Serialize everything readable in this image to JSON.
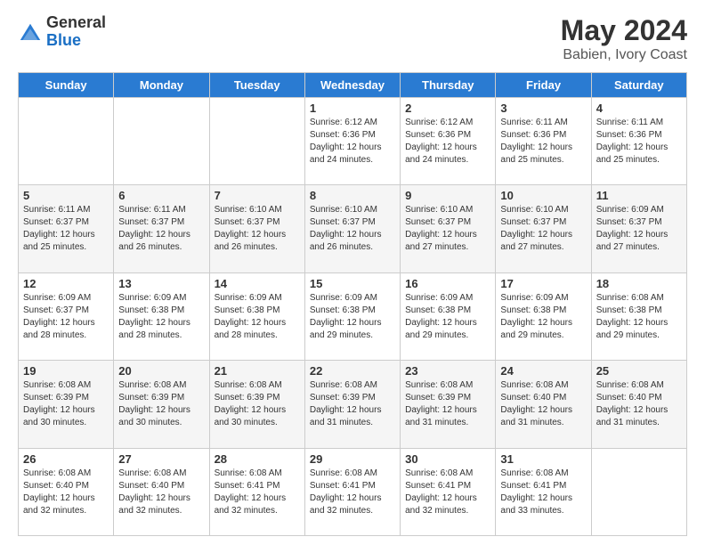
{
  "logo": {
    "general": "General",
    "blue": "Blue"
  },
  "header": {
    "month": "May 2024",
    "location": "Babien, Ivory Coast"
  },
  "days_of_week": [
    "Sunday",
    "Monday",
    "Tuesday",
    "Wednesday",
    "Thursday",
    "Friday",
    "Saturday"
  ],
  "weeks": [
    [
      {
        "day": null,
        "info": null
      },
      {
        "day": null,
        "info": null
      },
      {
        "day": null,
        "info": null
      },
      {
        "day": "1",
        "info": "Sunrise: 6:12 AM\nSunset: 6:36 PM\nDaylight: 12 hours and 24 minutes."
      },
      {
        "day": "2",
        "info": "Sunrise: 6:12 AM\nSunset: 6:36 PM\nDaylight: 12 hours and 24 minutes."
      },
      {
        "day": "3",
        "info": "Sunrise: 6:11 AM\nSunset: 6:36 PM\nDaylight: 12 hours and 25 minutes."
      },
      {
        "day": "4",
        "info": "Sunrise: 6:11 AM\nSunset: 6:36 PM\nDaylight: 12 hours and 25 minutes."
      }
    ],
    [
      {
        "day": "5",
        "info": "Sunrise: 6:11 AM\nSunset: 6:37 PM\nDaylight: 12 hours and 25 minutes."
      },
      {
        "day": "6",
        "info": "Sunrise: 6:11 AM\nSunset: 6:37 PM\nDaylight: 12 hours and 26 minutes."
      },
      {
        "day": "7",
        "info": "Sunrise: 6:10 AM\nSunset: 6:37 PM\nDaylight: 12 hours and 26 minutes."
      },
      {
        "day": "8",
        "info": "Sunrise: 6:10 AM\nSunset: 6:37 PM\nDaylight: 12 hours and 26 minutes."
      },
      {
        "day": "9",
        "info": "Sunrise: 6:10 AM\nSunset: 6:37 PM\nDaylight: 12 hours and 27 minutes."
      },
      {
        "day": "10",
        "info": "Sunrise: 6:10 AM\nSunset: 6:37 PM\nDaylight: 12 hours and 27 minutes."
      },
      {
        "day": "11",
        "info": "Sunrise: 6:09 AM\nSunset: 6:37 PM\nDaylight: 12 hours and 27 minutes."
      }
    ],
    [
      {
        "day": "12",
        "info": "Sunrise: 6:09 AM\nSunset: 6:37 PM\nDaylight: 12 hours and 28 minutes."
      },
      {
        "day": "13",
        "info": "Sunrise: 6:09 AM\nSunset: 6:38 PM\nDaylight: 12 hours and 28 minutes."
      },
      {
        "day": "14",
        "info": "Sunrise: 6:09 AM\nSunset: 6:38 PM\nDaylight: 12 hours and 28 minutes."
      },
      {
        "day": "15",
        "info": "Sunrise: 6:09 AM\nSunset: 6:38 PM\nDaylight: 12 hours and 29 minutes."
      },
      {
        "day": "16",
        "info": "Sunrise: 6:09 AM\nSunset: 6:38 PM\nDaylight: 12 hours and 29 minutes."
      },
      {
        "day": "17",
        "info": "Sunrise: 6:09 AM\nSunset: 6:38 PM\nDaylight: 12 hours and 29 minutes."
      },
      {
        "day": "18",
        "info": "Sunrise: 6:08 AM\nSunset: 6:38 PM\nDaylight: 12 hours and 29 minutes."
      }
    ],
    [
      {
        "day": "19",
        "info": "Sunrise: 6:08 AM\nSunset: 6:39 PM\nDaylight: 12 hours and 30 minutes."
      },
      {
        "day": "20",
        "info": "Sunrise: 6:08 AM\nSunset: 6:39 PM\nDaylight: 12 hours and 30 minutes."
      },
      {
        "day": "21",
        "info": "Sunrise: 6:08 AM\nSunset: 6:39 PM\nDaylight: 12 hours and 30 minutes."
      },
      {
        "day": "22",
        "info": "Sunrise: 6:08 AM\nSunset: 6:39 PM\nDaylight: 12 hours and 31 minutes."
      },
      {
        "day": "23",
        "info": "Sunrise: 6:08 AM\nSunset: 6:39 PM\nDaylight: 12 hours and 31 minutes."
      },
      {
        "day": "24",
        "info": "Sunrise: 6:08 AM\nSunset: 6:40 PM\nDaylight: 12 hours and 31 minutes."
      },
      {
        "day": "25",
        "info": "Sunrise: 6:08 AM\nSunset: 6:40 PM\nDaylight: 12 hours and 31 minutes."
      }
    ],
    [
      {
        "day": "26",
        "info": "Sunrise: 6:08 AM\nSunset: 6:40 PM\nDaylight: 12 hours and 32 minutes."
      },
      {
        "day": "27",
        "info": "Sunrise: 6:08 AM\nSunset: 6:40 PM\nDaylight: 12 hours and 32 minutes."
      },
      {
        "day": "28",
        "info": "Sunrise: 6:08 AM\nSunset: 6:41 PM\nDaylight: 12 hours and 32 minutes."
      },
      {
        "day": "29",
        "info": "Sunrise: 6:08 AM\nSunset: 6:41 PM\nDaylight: 12 hours and 32 minutes."
      },
      {
        "day": "30",
        "info": "Sunrise: 6:08 AM\nSunset: 6:41 PM\nDaylight: 12 hours and 32 minutes."
      },
      {
        "day": "31",
        "info": "Sunrise: 6:08 AM\nSunset: 6:41 PM\nDaylight: 12 hours and 33 minutes."
      },
      {
        "day": null,
        "info": null
      }
    ]
  ]
}
